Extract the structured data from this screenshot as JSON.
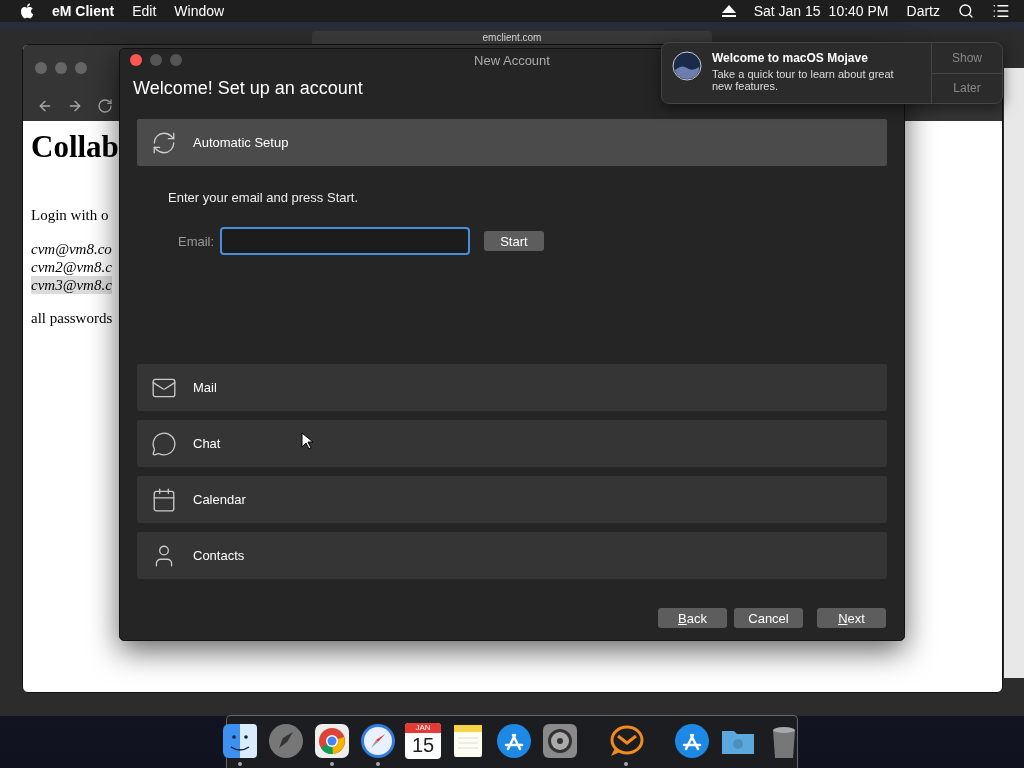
{
  "menu_bar": {
    "app": "eM Client",
    "menus": [
      "Edit",
      "Window"
    ],
    "date": "Sat Jan 15",
    "time": "10:40 PM",
    "user": "Dartz"
  },
  "background_window": {
    "url": "emclient.com"
  },
  "browser": {
    "heading": "Collab",
    "intro": "Login with o",
    "emails": [
      {
        "text": "cvm@vm8.co",
        "highlighted": false
      },
      {
        "text": "cvm2@vm8.c",
        "highlighted": false
      },
      {
        "text": "cvm3@vm8.c",
        "highlighted": true
      }
    ],
    "note": "all passwords"
  },
  "dialog": {
    "title": "New Account",
    "heading": "Welcome! Set up an account",
    "instruction": "Enter your email and press Start.",
    "email_label": "Email:",
    "start_button": "Start",
    "sections": [
      {
        "kind": "sync",
        "label": "Automatic Setup",
        "expanded": true
      },
      {
        "kind": "mail",
        "label": "Mail",
        "expanded": false
      },
      {
        "kind": "chat",
        "label": "Chat",
        "expanded": false
      },
      {
        "kind": "calendar",
        "label": "Calendar",
        "expanded": false
      },
      {
        "kind": "contacts",
        "label": "Contacts",
        "expanded": false
      }
    ],
    "buttons": [
      {
        "label": "Back",
        "underline_first": true
      },
      {
        "label": "Cancel",
        "underline_first": false
      },
      {
        "label": "Next",
        "underline_first": true
      }
    ]
  },
  "notification": {
    "title": "Welcome to macOS Mojave",
    "body": "Take a quick tour to learn about great new features.",
    "actions": [
      "Show",
      "Later"
    ]
  },
  "dock": {
    "items": [
      {
        "kind": "finder",
        "running": true
      },
      {
        "kind": "launchpad",
        "running": false
      },
      {
        "kind": "chrome",
        "running": true
      },
      {
        "kind": "safari",
        "running": true
      },
      {
        "kind": "calendar",
        "running": false,
        "month": "JAN",
        "day": "15"
      },
      {
        "kind": "notes",
        "running": false
      },
      {
        "kind": "appstore",
        "running": false
      },
      {
        "kind": "settings",
        "running": false
      },
      {
        "kind": "separator"
      },
      {
        "kind": "emclient",
        "running": true
      },
      {
        "kind": "separator"
      },
      {
        "kind": "downloads",
        "running": false
      },
      {
        "kind": "folder",
        "running": false
      },
      {
        "kind": "trash",
        "running": false
      }
    ]
  }
}
